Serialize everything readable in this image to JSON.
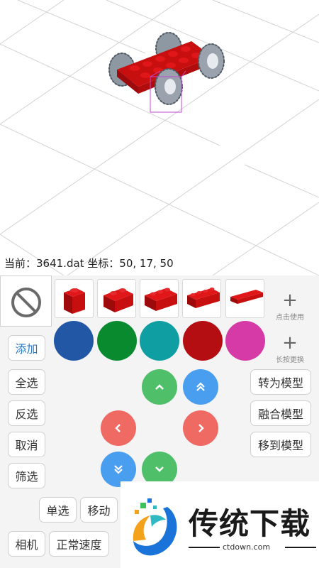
{
  "viewport": {
    "status": "当前：3641.dat 坐标：50, 17, 50"
  },
  "parts": [
    {
      "name": "brick-1x1"
    },
    {
      "name": "brick-1x2"
    },
    {
      "name": "brick-1x3"
    },
    {
      "name": "brick-1x4"
    },
    {
      "name": "plate-1x6"
    }
  ],
  "side_actions": {
    "tap_use": "点击使用",
    "long_press_replace": "长按更换"
  },
  "colors": [
    "#2257a6",
    "#0a8a2f",
    "#0f9ea1",
    "#b40d12",
    "#d63aa7"
  ],
  "buttons": {
    "add": "添加",
    "select_all": "全选",
    "invert": "反选",
    "cancel": "取消",
    "filter": "筛选",
    "single": "单选",
    "move": "移动",
    "camera": "相机",
    "speed": "正常速度",
    "to_model": "转为模型",
    "merge_model": "融合模型",
    "move_to_model": "移到模型"
  },
  "dpad_colors": {
    "green": "#4fbf6a",
    "blue": "#4a9ef0",
    "red": "#ef6a63"
  },
  "watermark": {
    "title": "传统下载",
    "url": "ctdown.com"
  }
}
